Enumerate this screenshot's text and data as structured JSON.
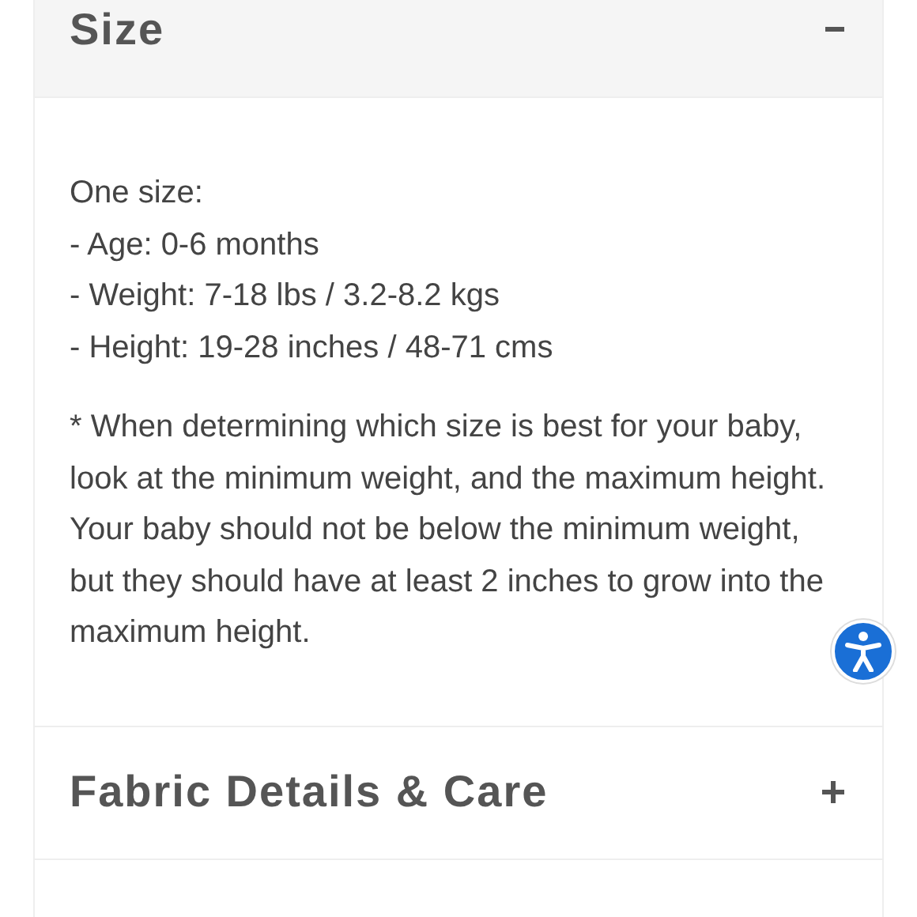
{
  "sections": [
    {
      "title": "Size",
      "expanded": true,
      "lines": [
        "One size:",
        "- Age: 0-6 months",
        "- Weight: 7-18 lbs / 3.2-8.2 kgs",
        "- Height: 19-28 inches / 48-71 cms"
      ],
      "note": "* When determining which size is best for your baby, look at the minimum weight, and the maximum height. Your baby should not be below the minimum weight, but they should have at least 2 inches to grow into the maximum height."
    },
    {
      "title": "Fabric Details & Care",
      "expanded": false
    }
  ]
}
